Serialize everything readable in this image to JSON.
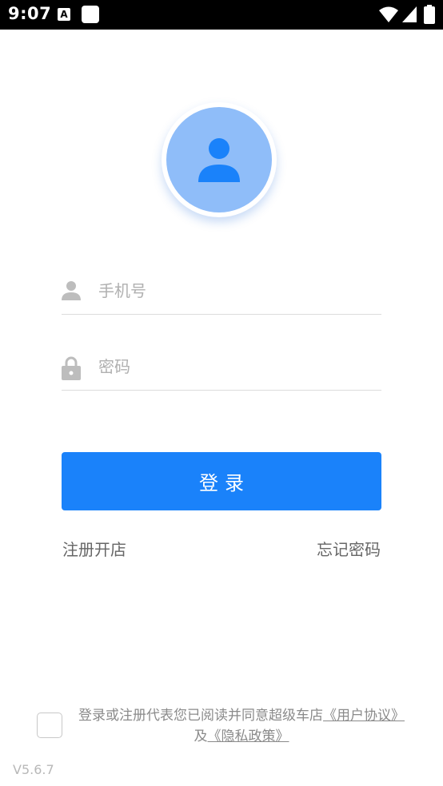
{
  "status_bar": {
    "time": "9:07",
    "a_label": "A"
  },
  "login_form": {
    "phone_placeholder": "手机号",
    "password_placeholder": "密码",
    "login_label": "登录"
  },
  "links": {
    "register": "注册开店",
    "forgot_password": "忘记密码"
  },
  "agreement": {
    "prefix": "登录或注册代表您已阅读并同意超级车店",
    "user_agreement": "《用户协议》",
    "connector": "及",
    "privacy_policy": "《隐私政策》"
  },
  "version": "V5.6.7",
  "colors": {
    "primary": "#1a82fa",
    "avatar_bg": "#8fbdf9",
    "icon_gray": "#bdbdbd"
  }
}
